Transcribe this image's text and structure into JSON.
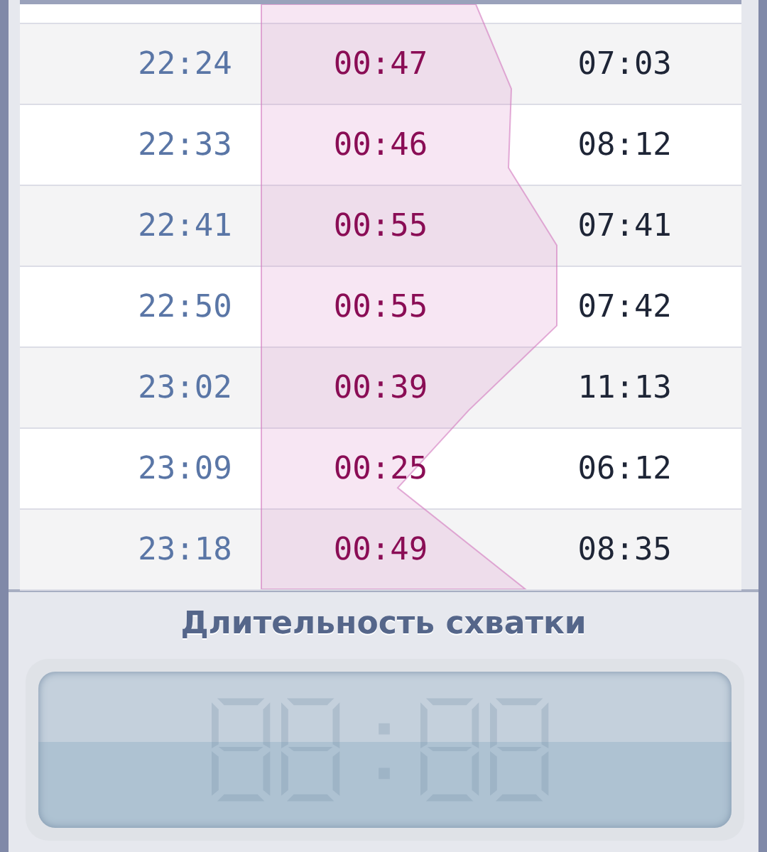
{
  "rows": [
    {
      "start": "22:24",
      "duration": "00:47",
      "interval": "07:03"
    },
    {
      "start": "22:33",
      "duration": "00:46",
      "interval": "08:12"
    },
    {
      "start": "22:41",
      "duration": "00:55",
      "interval": "07:41"
    },
    {
      "start": "22:50",
      "duration": "00:55",
      "interval": "07:42"
    },
    {
      "start": "23:02",
      "duration": "00:39",
      "interval": "11:13"
    },
    {
      "start": "23:09",
      "duration": "00:25",
      "interval": "06:12"
    },
    {
      "start": "23:18",
      "duration": "00:49",
      "interval": "08:35"
    }
  ],
  "panel": {
    "title": "Длительность схватки"
  }
}
